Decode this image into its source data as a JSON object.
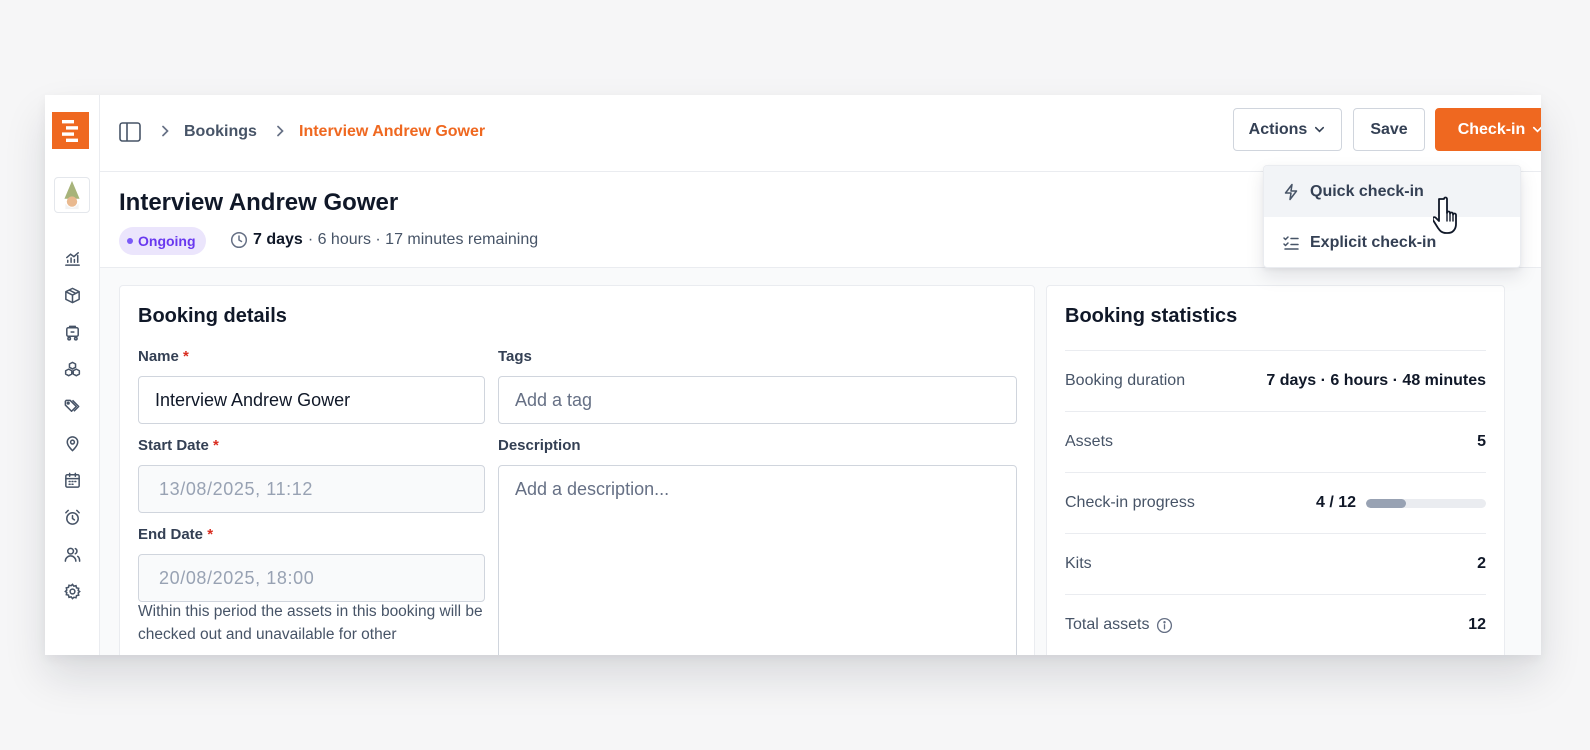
{
  "breadcrumb": {
    "items": [
      "Bookings",
      "Interview Andrew Gower"
    ]
  },
  "header": {
    "actions_label": "Actions",
    "save_label": "Save",
    "checkin_label": "Check-in"
  },
  "dropdown": {
    "items": [
      {
        "label": "Quick check-in",
        "icon": "lightning-icon"
      },
      {
        "label": "Explicit check-in",
        "icon": "checklist-icon"
      }
    ]
  },
  "booking": {
    "title": "Interview Andrew Gower",
    "status": "Ongoing",
    "remaining_bold": "7 days",
    "remaining_rest": "· 6 hours · 17 minutes remaining"
  },
  "details": {
    "title": "Booking details",
    "name_label": "Name",
    "required_mark": "*",
    "name_value": "Interview Andrew Gower",
    "tags_label": "Tags",
    "tags_placeholder": "Add a tag",
    "start_label": "Start Date",
    "start_value": "13/08/2025, 11:12",
    "description_label": "Description",
    "description_placeholder": "Add a description...",
    "end_label": "End Date",
    "end_value": "20/08/2025, 18:00",
    "hint": "Within this period the assets in this booking will be checked out and unavailable for other"
  },
  "stats": {
    "title": "Booking statistics",
    "rows": [
      {
        "label": "Booking duration",
        "value": "7 days · 6 hours · 48 minutes"
      },
      {
        "label": "Assets",
        "value": "5"
      },
      {
        "label": "Check-in progress",
        "value": "4 / 12",
        "progress": 0.333
      },
      {
        "label": "Kits",
        "value": "2"
      },
      {
        "label": "Total assets",
        "value": "12"
      }
    ]
  },
  "colors": {
    "brand": "#ef6820",
    "status_bg": "#ebe5fc",
    "status_text": "#6938ef"
  },
  "sidebar": {
    "icons": [
      "chart-icon",
      "box-icon",
      "cart-icon",
      "kits-icon",
      "tags-icon",
      "location-icon",
      "calendar-icon",
      "alarm-icon",
      "users-icon",
      "settings-icon"
    ]
  }
}
